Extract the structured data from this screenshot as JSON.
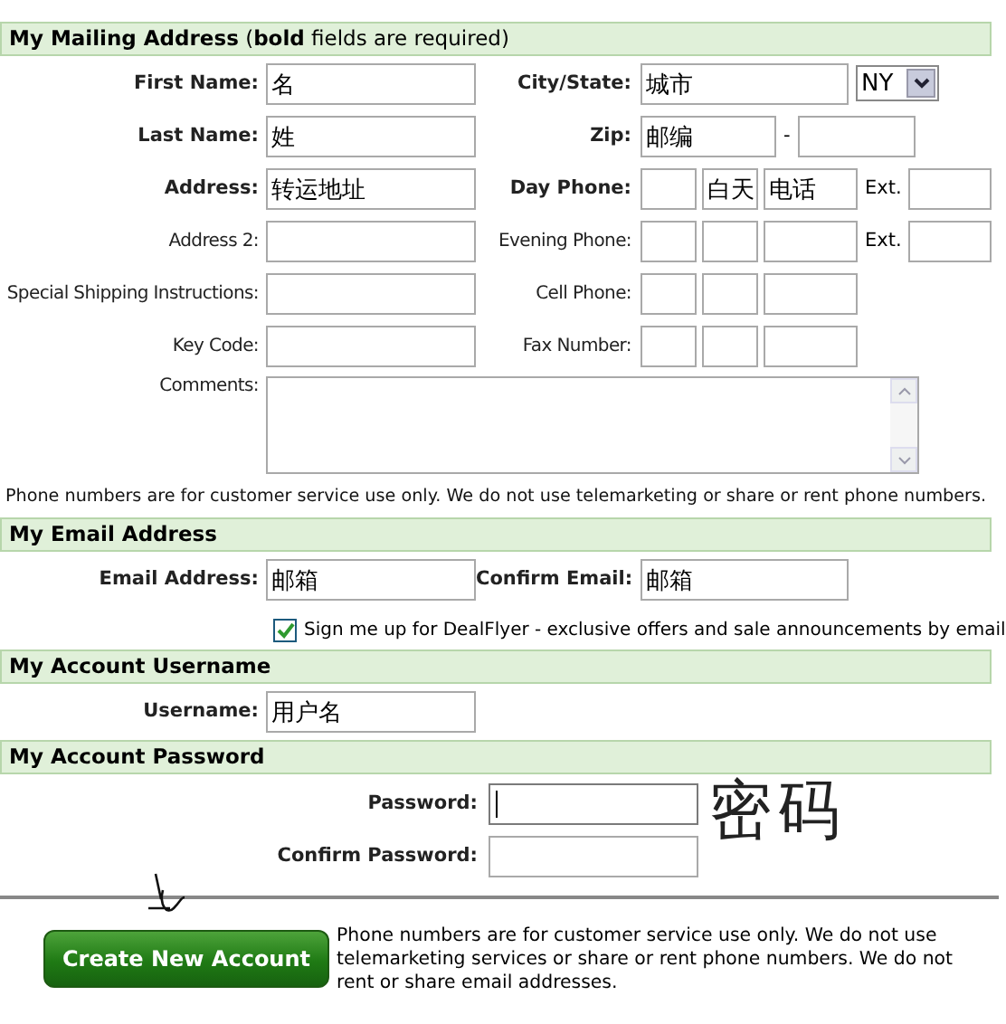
{
  "mailing": {
    "title": "**My Mailing Address** (**bold** fields are required)",
    "rows": [
      {
        "left": {
          "label": "First Name:",
          "required": true,
          "value": "名"
        },
        "right": {
          "kind": "city",
          "label": "City/State:",
          "required": true,
          "value": "城市",
          "select": "NY"
        }
      },
      {
        "left": {
          "label": "Last Name:",
          "required": true,
          "value": "姓"
        },
        "right": {
          "kind": "zip",
          "label": "Zip:",
          "required": true,
          "value": "邮编",
          "separator": "-"
        }
      },
      {
        "left": {
          "label": "Address:",
          "required": true,
          "value": "转运地址"
        },
        "right": {
          "kind": "phone",
          "label": "Day Phone:",
          "required": true,
          "parts": [
            {
              "kind": "blank"
            },
            {
              "kind": "text",
              "value": "白天"
            },
            {
              "kind": "text",
              "value": "电话"
            }
          ],
          "ext": "Ext."
        }
      },
      {
        "left": {
          "label": "Address 2:",
          "required": false
        },
        "right": {
          "kind": "phone",
          "label": "Evening Phone:",
          "required": false,
          "parts": [
            {
              "kind": "blank"
            },
            {
              "kind": "blank"
            },
            {
              "kind": "blank"
            }
          ],
          "ext": "Ext."
        }
      },
      {
        "left": {
          "label": "Special Shipping Instructions:",
          "required": false
        },
        "right": {
          "kind": "phone",
          "label": "Cell Phone:",
          "required": false,
          "parts": [
            {
              "kind": "blank"
            },
            {
              "kind": "blank"
            },
            {
              "kind": "blank"
            }
          ]
        }
      },
      {
        "left": {
          "label": "Key Code:",
          "required": false
        },
        "right": {
          "kind": "phone",
          "label": "Fax Number:",
          "required": false,
          "parts": [
            {
              "kind": "blank"
            },
            {
              "kind": "blank"
            },
            {
              "kind": "blank"
            }
          ]
        }
      }
    ],
    "comments": {
      "label": "Comments:"
    },
    "notice": "Phone numbers are for customer service use only. We do not use telemarketing or share or rent phone numbers."
  },
  "email": {
    "title": "My Email Address",
    "field": {
      "label": "Email Address:",
      "value": "邮箱"
    },
    "confirm": {
      "label": "Confirm Email:",
      "value": "邮箱"
    },
    "newsletter": {
      "label": "Sign me up for DealFlyer - exclusive offers and sale announcements by email",
      "checked": true
    }
  },
  "username": {
    "title": "My Account Username",
    "field": {
      "label": "Username:",
      "value": "用户名"
    }
  },
  "password": {
    "title": "My Account Password",
    "fields": [
      {
        "label": "Password:",
        "focused": true
      },
      {
        "label": "Confirm Password:",
        "focused": false
      }
    ],
    "annotation": "密码"
  },
  "footer": {
    "button": "Create New Account",
    "notice": "Phone numbers are for customer service use only. We do not use telemarketing services or share or rent phone numbers. We do not rent or share email addresses."
  }
}
